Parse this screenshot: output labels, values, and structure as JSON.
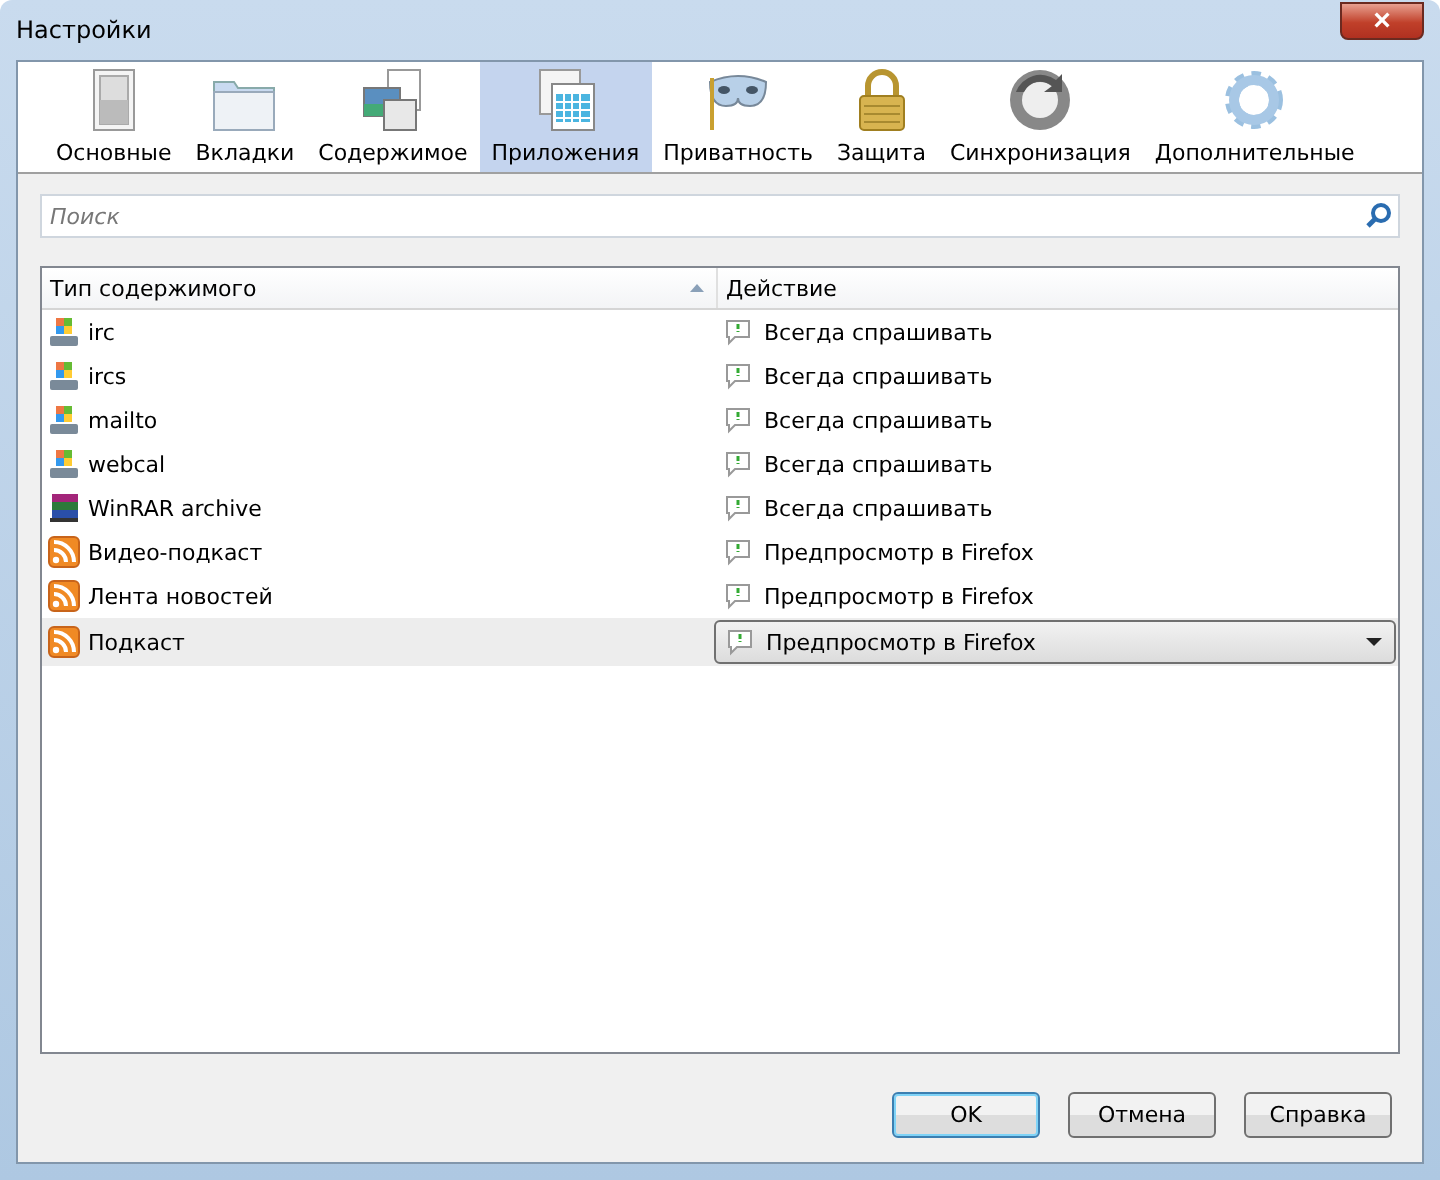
{
  "window": {
    "title": "Настройки",
    "close": "×"
  },
  "tabs": [
    {
      "label": "Основные",
      "kind": "switch",
      "selected": false
    },
    {
      "label": "Вкладки",
      "kind": "folder",
      "selected": false
    },
    {
      "label": "Содержимое",
      "kind": "content",
      "selected": false
    },
    {
      "label": "Приложения",
      "kind": "apps",
      "selected": true
    },
    {
      "label": "Приватность",
      "kind": "mask",
      "selected": false
    },
    {
      "label": "Защита",
      "kind": "lock",
      "selected": false
    },
    {
      "label": "Синхронизация",
      "kind": "sync",
      "selected": false
    },
    {
      "label": "Дополнительные",
      "kind": "gear",
      "selected": false
    }
  ],
  "search": {
    "placeholder": "Поиск"
  },
  "table": {
    "columns": [
      {
        "label": "Тип содержимого",
        "sorted": true
      },
      {
        "label": "Действие",
        "sorted": false
      }
    ],
    "rows": [
      {
        "type": "irc",
        "kind": "app",
        "action": "Всегда спрашивать",
        "selected": false
      },
      {
        "type": "ircs",
        "kind": "app",
        "action": "Всегда спрашивать",
        "selected": false
      },
      {
        "type": "mailto",
        "kind": "app",
        "action": "Всегда спрашивать",
        "selected": false
      },
      {
        "type": "webcal",
        "kind": "app",
        "action": "Всегда спрашивать",
        "selected": false
      },
      {
        "type": "WinRAR archive",
        "kind": "archive",
        "action": "Всегда спрашивать",
        "selected": false
      },
      {
        "type": "Видео-подкаст",
        "kind": "feed",
        "action": "Предпросмотр в Firefox",
        "selected": false
      },
      {
        "type": "Лента новостей",
        "kind": "feed",
        "action": "Предпросмотр в Firefox",
        "selected": false
      },
      {
        "type": "Подкаст",
        "kind": "feed",
        "action": "Предпросмотр в Firefox",
        "selected": true
      }
    ]
  },
  "buttons": [
    {
      "label": "OK",
      "default": true
    },
    {
      "label": "Отмена",
      "default": false
    },
    {
      "label": "Справка",
      "default": false
    }
  ]
}
